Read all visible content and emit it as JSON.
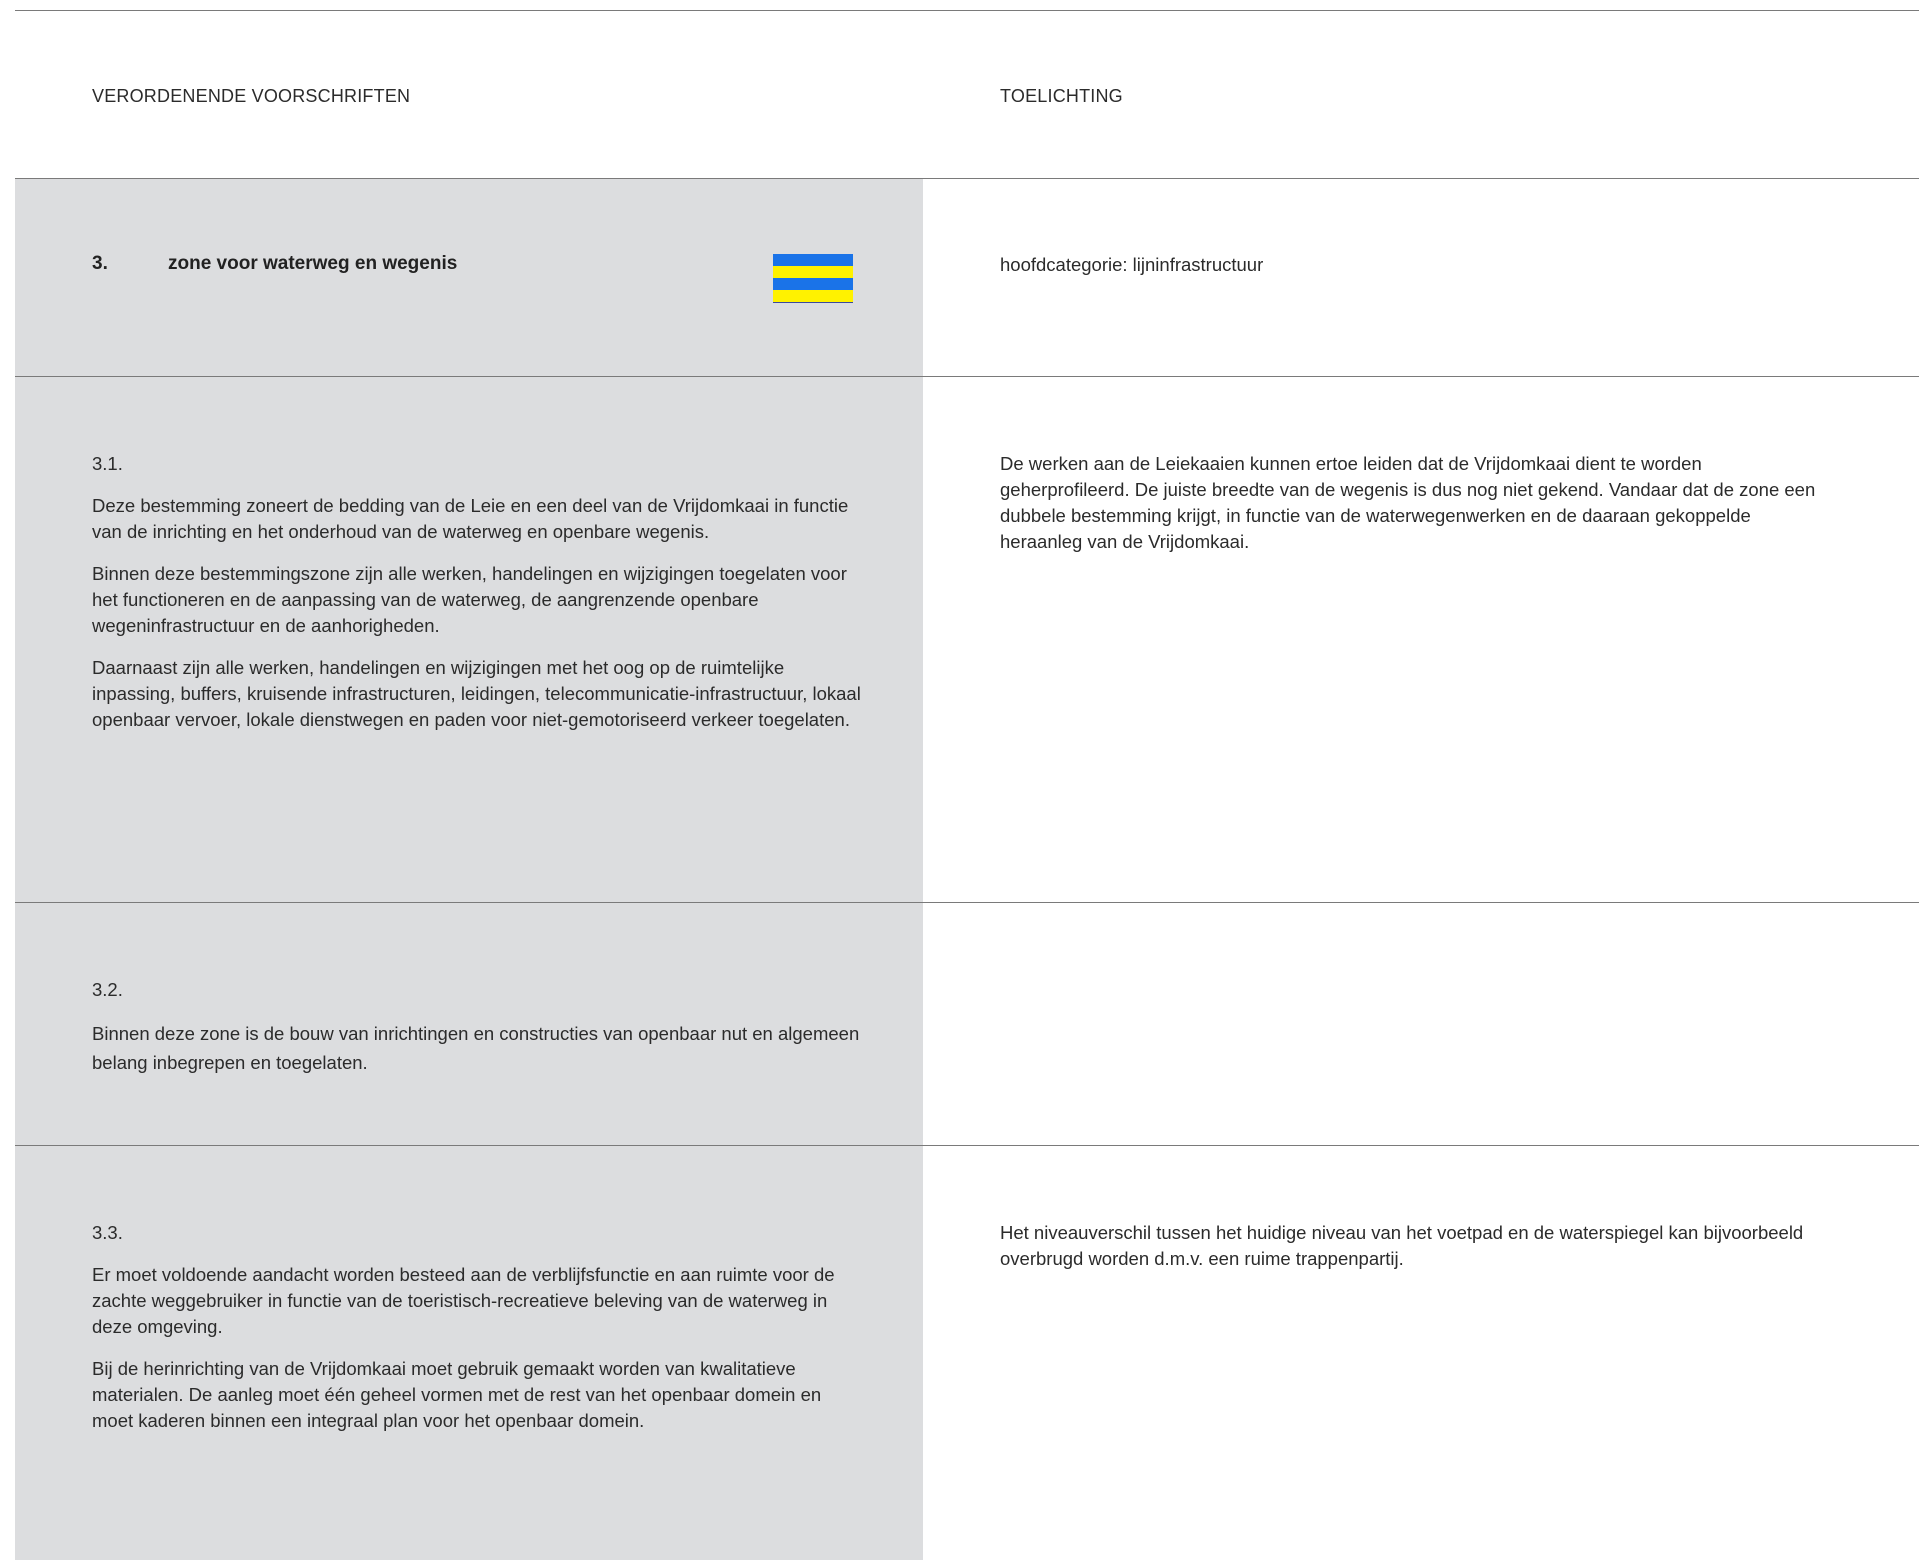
{
  "header": {
    "left_title": "VERORDENENDE VOORSCHRIFTEN",
    "right_title": "TOELICHTING"
  },
  "section": {
    "number": "3.",
    "title": "zone voor waterweg en wegenis",
    "legend_colors": [
      "#1a73e8",
      "#fff200",
      "#1a73e8",
      "#fff200"
    ],
    "category": "hoofdcategorie: lijninfrastructuur"
  },
  "articles": [
    {
      "number": "3.1.",
      "paragraphs": [
        "Deze bestemming zoneert de bedding van de Leie en een deel van de Vrijdomkaai in functie van de inrichting en het onderhoud van de waterweg en openbare wegenis.",
        "Binnen deze bestemmingszone zijn alle werken, handelingen en wijzigingen toegelaten voor het functioneren en de aanpassing van de waterweg, de aangrenzende openbare wegeninfrastructuur en de aanhorigheden.",
        "Daarnaast zijn alle werken, handelingen en wijzigingen met het oog op de ruimtelijke inpassing, buffers, kruisende infrastructuren, leidingen, telecommunicatie-infrastructuur, lokaal openbaar vervoer, lokale dienstwegen en paden voor niet-gemotoriseerd verkeer toegelaten."
      ],
      "explanation": "De werken aan de Leiekaaien kunnen ertoe leiden dat de Vrijdomkaai dient te worden geherprofileerd. De juiste breedte van de wegenis is dus nog niet gekend. Vandaar dat de zone een dubbele bestemming krijgt, in functie van de waterwegenwerken en de daaraan gekoppelde heraanleg van de Vrijdomkaai."
    },
    {
      "number": "3.2.",
      "paragraphs": [
        "Binnen deze zone is de bouw van inrichtingen en constructies van openbaar nut en algemeen belang inbegrepen en toegelaten."
      ],
      "explanation": ""
    },
    {
      "number": "3.3.",
      "paragraphs": [
        "Er moet voldoende aandacht worden besteed aan de verblijfsfunctie en aan ruimte voor de zachte weggebruiker in functie van de toeristisch-recreatieve beleving van de waterweg in deze omgeving.",
        "Bij de herinrichting van de Vrijdomkaai moet gebruik gemaakt worden van kwalitatieve materialen. De aanleg moet één geheel vormen met de rest van het openbaar domein en moet kaderen binnen een integraal plan voor het openbaar domein."
      ],
      "explanation": "Het niveauverschil tussen het huidige niveau van het voetpad en de waterspiegel kan bijvoorbeeld overbrugd worden d.m.v. een ruime trappenpartij."
    }
  ]
}
